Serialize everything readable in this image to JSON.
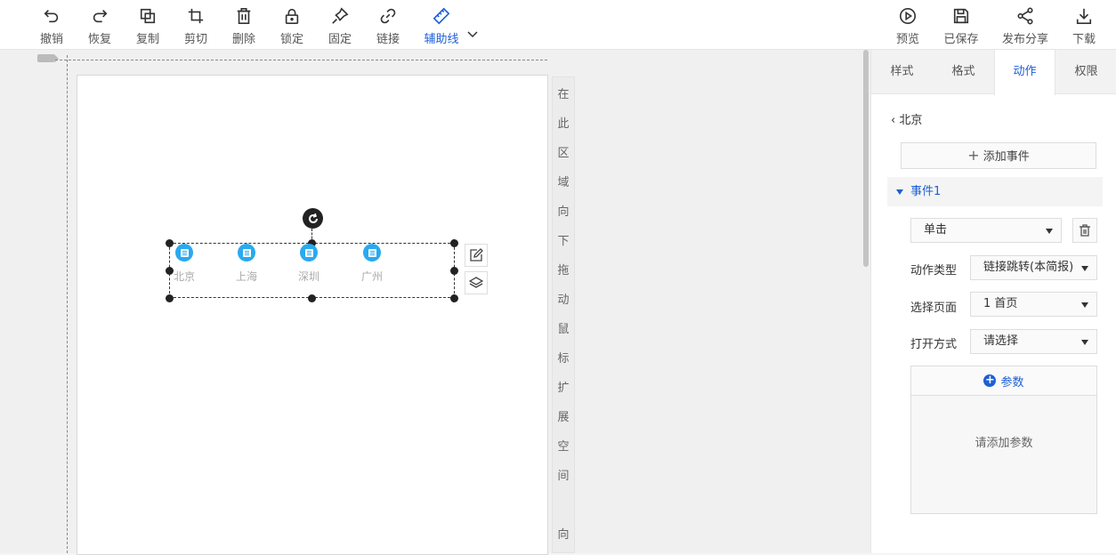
{
  "toolbar": {
    "left": [
      {
        "label": "撤销",
        "icon": "undo-icon"
      },
      {
        "label": "恢复",
        "icon": "redo-icon"
      },
      {
        "label": "复制",
        "icon": "copy-icon"
      },
      {
        "label": "剪切",
        "icon": "crop-icon"
      },
      {
        "label": "删除",
        "icon": "trash-icon"
      },
      {
        "label": "锁定",
        "icon": "lock-icon"
      },
      {
        "label": "固定",
        "icon": "pin-icon"
      },
      {
        "label": "链接",
        "icon": "link-icon"
      },
      {
        "label": "辅助线",
        "icon": "ruler-icon"
      }
    ],
    "right": [
      {
        "label": "预览",
        "icon": "play-icon"
      },
      {
        "label": "已保存",
        "icon": "save-icon"
      },
      {
        "label": "发布分享",
        "icon": "share-icon"
      },
      {
        "label": "下载",
        "icon": "download-icon"
      }
    ],
    "active_color": "#1e5fd6"
  },
  "canvas": {
    "hint_chars": [
      "在",
      "此",
      "区",
      "域",
      "向",
      "下",
      "拖",
      "动",
      "鼠",
      "标",
      "扩",
      "展",
      "空",
      "间",
      "向"
    ],
    "tabs": [
      "北京",
      "上海",
      "深圳",
      "广州"
    ],
    "tab_icon_color": "#29aaf0"
  },
  "panel": {
    "tabs": [
      "样式",
      "格式",
      "动作",
      "权限"
    ],
    "active_tab": "动作",
    "back_label": "北京",
    "add_event_label": "添加事件",
    "event_title": "事件1",
    "trigger_value": "单击",
    "rows": [
      {
        "label": "动作类型",
        "value": "链接跳转(本简报)"
      },
      {
        "label": "选择页面",
        "value": "1 首页"
      },
      {
        "label": "打开方式",
        "value": "请选择"
      }
    ],
    "params_label": "参数",
    "params_empty": "请添加参数"
  }
}
